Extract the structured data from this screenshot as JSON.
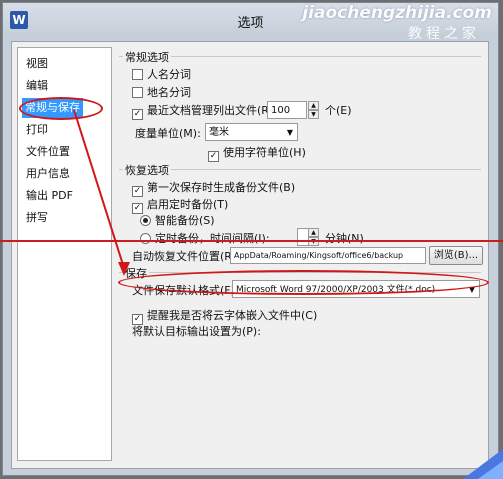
{
  "window": {
    "title": "选项",
    "app_icon": "W",
    "watermark": "jiaochengzhijia.com",
    "watermark_sub": "教程之家"
  },
  "nav": {
    "items": [
      {
        "label": "视图"
      },
      {
        "label": "编辑"
      },
      {
        "label": "常规与保存"
      },
      {
        "label": "打印"
      },
      {
        "label": "文件位置"
      },
      {
        "label": "用户信息"
      },
      {
        "label": "输出 PDF"
      },
      {
        "label": "拼写"
      }
    ]
  },
  "general": {
    "title": "常规选项",
    "person_name": "人名分词",
    "place_name": "地名分词",
    "recent_files": "最近文档管理列出文件(R):",
    "recent_count": "100",
    "recent_unit": "个(E)",
    "unit_label": "度量单位(M):",
    "unit_value": "毫米",
    "char_unit": "使用字符单位(H)"
  },
  "recovery": {
    "title": "恢复选项",
    "first_backup": "第一次保存时生成备份文件(B)",
    "timed_backup": "启用定时备份(T)",
    "smart_backup": "智能备份(S)",
    "interval_backup": "定时备份，时间间隔(I):",
    "minutes": "分钟(N)",
    "auto_location_label": "自动恢复文件位置(R):",
    "auto_location_path": "AppData/Roaming/Kingsoft/office6/backup",
    "browse": "浏览(B)..."
  },
  "save": {
    "title": "保存",
    "format_label": "文件保存默认格式(F):",
    "format_value": "Microsoft Word 97/2000/XP/2003 文件(*.doc)",
    "cloud_fonts": "提醒我是否将云字体嵌入文件中(C)",
    "default_target": "将默认目标输出设置为(P):"
  },
  "colors": {
    "highlight": "#3399ff",
    "annotation": "#d01818"
  }
}
